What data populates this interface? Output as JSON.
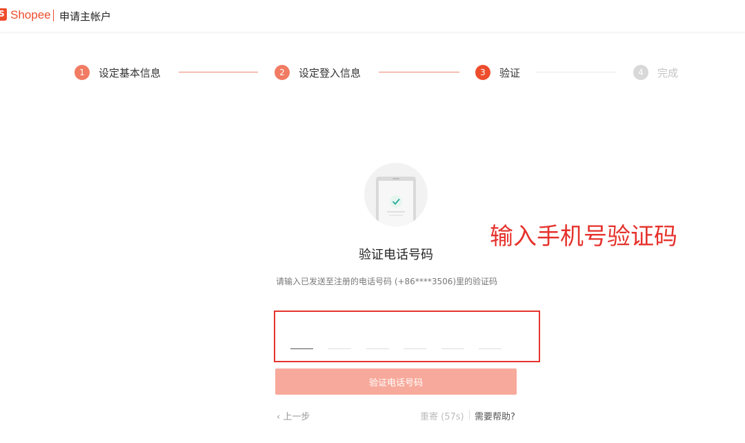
{
  "header": {
    "logo_glyph": "S",
    "brand": "Shopee",
    "title": "申请主帐户"
  },
  "steps": [
    {
      "number": "1",
      "label": "设定基本信息",
      "state": "done"
    },
    {
      "number": "2",
      "label": "设定登入信息",
      "state": "done"
    },
    {
      "number": "3",
      "label": "验证",
      "state": "current"
    },
    {
      "number": "4",
      "label": "完成",
      "state": "pending"
    }
  ],
  "colors": {
    "accent": "#ee4d2d",
    "step_done": "#f17b63",
    "step_pending": "#d8d8d8",
    "button_disabled": "#f7a99b",
    "annotation": "#e5322c"
  },
  "illustration_icon": "phone-check-icon",
  "verify": {
    "title": "验证电话号码",
    "instruction": "请输入已发送至注册的电话号码 (+86****3506)里的验证码",
    "code_digits": [
      "",
      "",
      "",
      "",
      "",
      ""
    ],
    "button_label": "验证电话号码"
  },
  "annotation": {
    "text": "输入手机号验证码"
  },
  "footer": {
    "back_label": "‹ 上一步",
    "resend_label": "重寄 (57s)",
    "help_label": "需要帮助?"
  }
}
